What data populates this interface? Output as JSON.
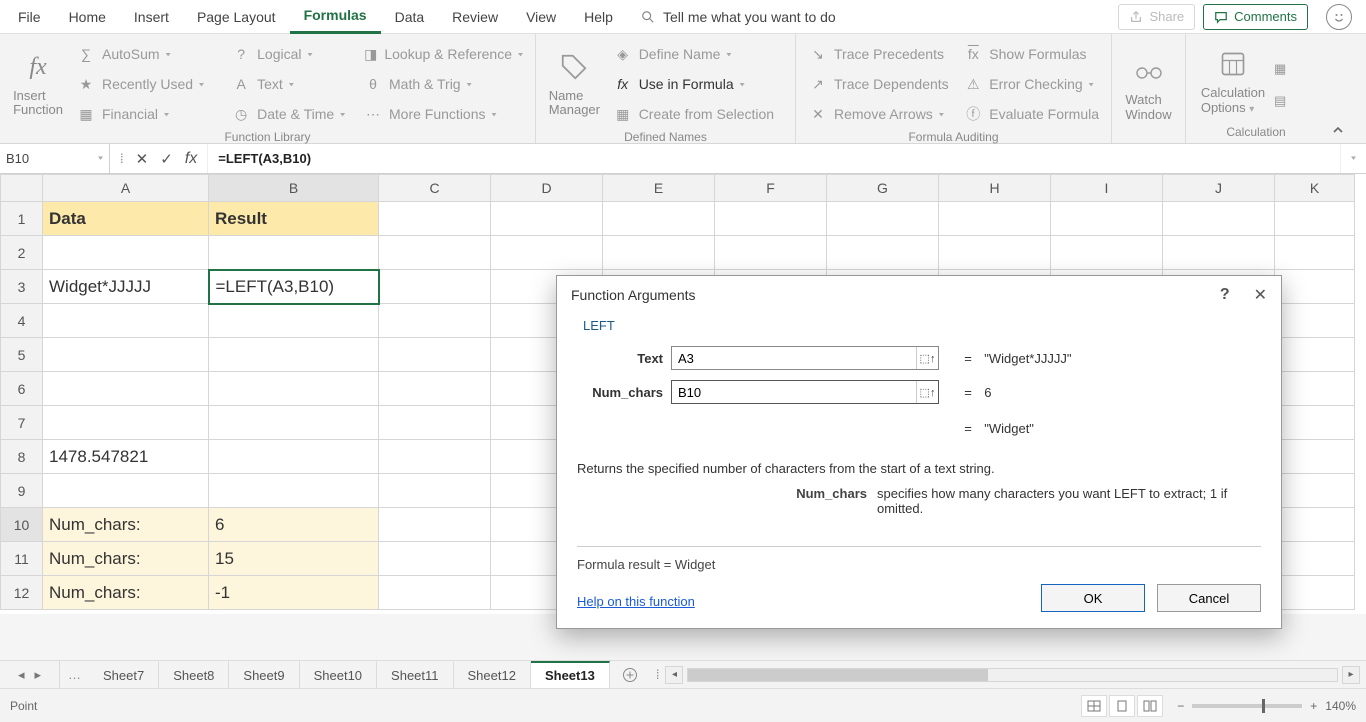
{
  "menu": {
    "tabs": [
      "File",
      "Home",
      "Insert",
      "Page Layout",
      "Formulas",
      "Data",
      "Review",
      "View",
      "Help"
    ],
    "active": "Formulas",
    "tell_me": "Tell me what you want to do",
    "share": "Share",
    "comments": "Comments"
  },
  "ribbon": {
    "insert_fn": {
      "label1": "Insert",
      "label2": "Function"
    },
    "function_library": {
      "label": "Function Library",
      "col1": [
        "AutoSum",
        "Recently Used",
        "Financial"
      ],
      "col2": [
        "Logical",
        "Text",
        "Date & Time"
      ],
      "col3": [
        "Lookup & Reference",
        "Math & Trig",
        "More Functions"
      ]
    },
    "defined_names": {
      "label": "Defined Names",
      "name_mgr1": "Name",
      "name_mgr2": "Manager",
      "items": [
        "Define Name",
        "Use in Formula",
        "Create from Selection"
      ]
    },
    "auditing": {
      "label": "Formula Auditing",
      "left": [
        "Trace Precedents",
        "Trace Dependents",
        "Remove Arrows"
      ],
      "right": [
        "Show Formulas",
        "Error Checking",
        "Evaluate Formula"
      ]
    },
    "watch": {
      "l1": "Watch",
      "l2": "Window"
    },
    "calc": {
      "l1": "Calculation",
      "l2": "Options",
      "label": "Calculation"
    }
  },
  "formula_bar": {
    "name_box": "B10",
    "formula": "=LEFT(A3,B10)"
  },
  "grid": {
    "columns": [
      "A",
      "B",
      "C",
      "D",
      "E",
      "F",
      "G",
      "H",
      "I",
      "J",
      "K"
    ],
    "rows": [
      {
        "n": "1",
        "A": "Data",
        "B": "Result",
        "hdr": true
      },
      {
        "n": "2"
      },
      {
        "n": "3",
        "A": "Widget*JJJJJ",
        "B": "=LEFT(A3,B10)",
        "active": true
      },
      {
        "n": "4"
      },
      {
        "n": "5"
      },
      {
        "n": "6"
      },
      {
        "n": "7"
      },
      {
        "n": "8",
        "A": "1478.547821"
      },
      {
        "n": "9"
      },
      {
        "n": "10",
        "A": "Num_chars:",
        "B": "6",
        "hl": true,
        "marching": true
      },
      {
        "n": "11",
        "A": "Num_chars:",
        "B": " 15",
        "hl": true
      },
      {
        "n": "12",
        "A": "Num_chars:",
        "B": " -1",
        "hl": true
      }
    ]
  },
  "dialog": {
    "title": "Function Arguments",
    "fn": "LEFT",
    "args": [
      {
        "label": "Text",
        "value": "A3",
        "result": "\"Widget*JJJJJ\""
      },
      {
        "label": "Num_chars",
        "value": "B10",
        "result": "6"
      }
    ],
    "final_eq": "\"Widget\"",
    "desc": "Returns the specified number of characters from the start of a text string.",
    "param_name": "Num_chars",
    "param_desc": "specifies how many characters you want LEFT to extract; 1 if omitted.",
    "formula_result_lbl": "Formula result =  ",
    "formula_result": "Widget",
    "help": "Help on this function",
    "ok": "OK",
    "cancel": "Cancel"
  },
  "sheets": {
    "tabs": [
      "Sheet7",
      "Sheet8",
      "Sheet9",
      "Sheet10",
      "Sheet11",
      "Sheet12",
      "Sheet13"
    ],
    "active": "Sheet13"
  },
  "status": {
    "mode": "Point",
    "zoom": "140%"
  }
}
